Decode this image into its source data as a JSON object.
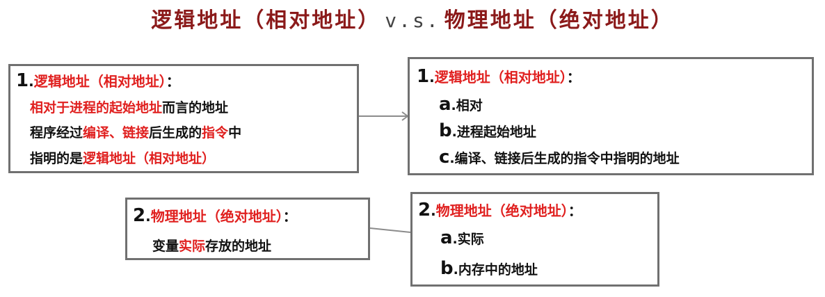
{
  "title": {
    "part1": "逻辑地址（相对地址）",
    "vs": "v.s.",
    "part2": "物理地址（绝对地址）"
  },
  "left_box_1": {
    "num": "1",
    "dot": ".",
    "heading": "逻辑地址（相对地址）",
    "colon": "：",
    "line1_red": "相对于进程的起始地址",
    "line1_black": "而言的地址",
    "line2_a": "程序经过",
    "line2_red1": "编译、链接",
    "line2_b": "后生成的",
    "line2_red2": "指令",
    "line2_c": "中",
    "line3_black": "指明的是",
    "line3_red": "逻辑地址（相对地址）"
  },
  "right_box_1": {
    "num": "1",
    "dot": ".",
    "heading": "逻辑地址（相对地址）",
    "colon": "：",
    "items": [
      {
        "letter": "a",
        "text": ".相对"
      },
      {
        "letter": "b",
        "text": ".进程起始地址"
      },
      {
        "letter": "c",
        "text": ".编译、链接后生成的指令中指明的地址"
      }
    ]
  },
  "left_box_2": {
    "num": "2",
    "dot": ".",
    "heading": "物理地址（绝对地址）",
    "colon": "：",
    "line1_a": "变量",
    "line1_red": "实际",
    "line1_b": "存放的地址"
  },
  "right_box_2": {
    "num": "2",
    "dot": ".",
    "heading": "物理地址（绝对地址）",
    "colon": "：",
    "items": [
      {
        "letter": "a",
        "text": ".实际"
      },
      {
        "letter": "b",
        "text": ".内存中的地址"
      }
    ]
  },
  "colors": {
    "title_red": "#8b1a1a",
    "accent_red": "#e0201f",
    "border_gray": "#707070"
  }
}
